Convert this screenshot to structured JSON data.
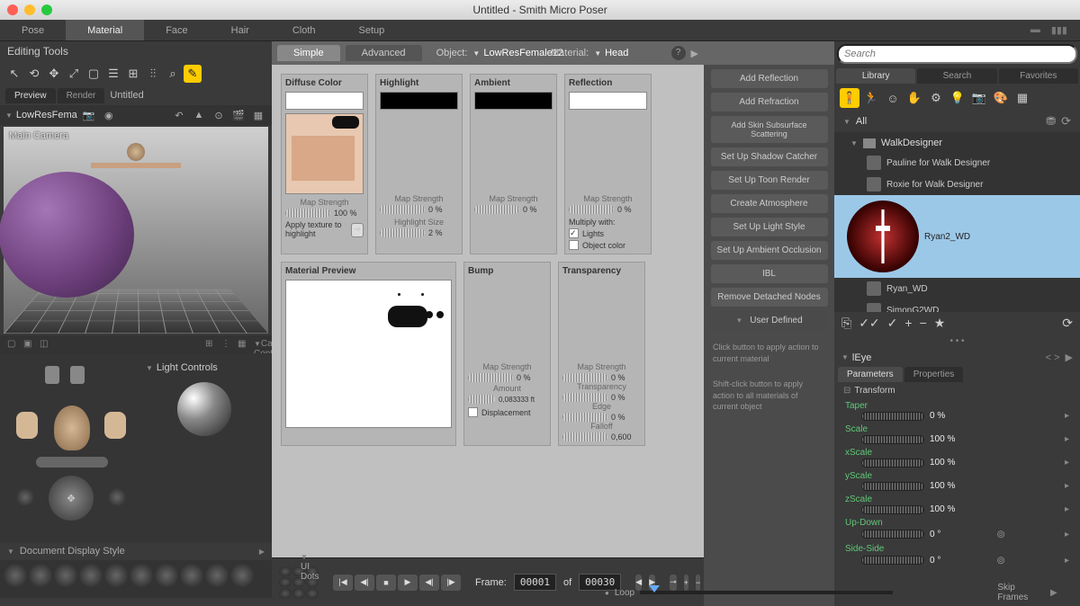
{
  "window": {
    "title": "Untitled - Smith Micro Poser"
  },
  "mainTabs": {
    "items": [
      "Pose",
      "Material",
      "Face",
      "Hair",
      "Cloth",
      "Setup"
    ],
    "active": "Material"
  },
  "leftPanel": {
    "editingTools": "Editing Tools",
    "previewTab": "Preview",
    "renderTab": "Render",
    "untitled": "Untitled",
    "figureDropdown": "LowResFema",
    "viewportLabel": "Main Camera",
    "cameraControls": "Camera Controls",
    "lightControls": "Light Controls",
    "displayStyle": "Document Display Style"
  },
  "center": {
    "simpleTab": "Simple",
    "advancedTab": "Advanced",
    "objectLabel": "Object:",
    "objectValue": "LowResFemale12",
    "materialLabel": "Material:",
    "materialValue": "Head",
    "diffuse": {
      "title": "Diffuse Color",
      "mapStrength": "Map Strength",
      "mapVal": "100 %",
      "apply": "Apply texture to highlight"
    },
    "highlight": {
      "title": "Highlight",
      "mapStrength": "Map Strength",
      "mapVal": "0 %",
      "sizeLabel": "Highlight Size",
      "sizeVal": "2 %"
    },
    "ambient": {
      "title": "Ambient",
      "mapStrength": "Map Strength",
      "mapVal": "0 %"
    },
    "reflection": {
      "title": "Reflection",
      "mapStrength": "Map Strength",
      "mapVal": "0 %",
      "multiply": "Multiply with:",
      "lights": "Lights",
      "objColor": "Object color"
    },
    "preview": {
      "title": "Material Preview"
    },
    "bump": {
      "title": "Bump",
      "mapStrength": "Map Strength",
      "mapVal": "0 %",
      "amountLabel": "Amount",
      "amountVal": "0,083333 ft",
      "dispLabel": "Displacement"
    },
    "transparency": {
      "title": "Transparency",
      "mapStrength": "Map Strength",
      "mapVal": "0 %",
      "transLabel": "Transparency",
      "transVal": "0 %",
      "edgeLabel": "Edge",
      "edgeVal": "0 %",
      "falloffLabel": "Falloff",
      "falloffVal": "0,600"
    }
  },
  "actions": {
    "buttons": [
      "Add Reflection",
      "Add Refraction",
      "Add Skin Subsurface Scattering",
      "Set Up Shadow Catcher",
      "Set Up Toon Render",
      "Create Atmosphere",
      "Set Up Light Style",
      "Set Up Ambient Occlusion",
      "IBL",
      "Remove Detached Nodes",
      "User Defined"
    ],
    "hint1": "Click button to apply action to current material",
    "hint2": "Shift-click button to apply action to all materials of current object"
  },
  "library": {
    "searchPlaceholder": "Search",
    "tabs": [
      "Library",
      "Search",
      "Favorites"
    ],
    "all": "All",
    "folder": "WalkDesigner",
    "items": [
      {
        "label": "Pauline for Walk Designer"
      },
      {
        "label": "Roxie for Walk Designer"
      },
      {
        "label": "Ryan2_WD",
        "selected": true
      },
      {
        "label": "Ryan_WD"
      },
      {
        "label": "SimonG2WD"
      }
    ]
  },
  "params": {
    "header": "lEye",
    "tabs": [
      "Parameters",
      "Properties"
    ],
    "group": "Transform",
    "rows": [
      {
        "name": "Taper",
        "val": "0 %"
      },
      {
        "name": "Scale",
        "val": "100 %"
      },
      {
        "name": "xScale",
        "val": "100 %"
      },
      {
        "name": "yScale",
        "val": "100 %"
      },
      {
        "name": "zScale",
        "val": "100 %"
      },
      {
        "name": "Up-Down",
        "val": "0 °",
        "key": true
      },
      {
        "name": "Side-Side",
        "val": "0 °",
        "key": true
      }
    ]
  },
  "timeline": {
    "uiDots": "UI Dots",
    "frameLabel": "Frame:",
    "frameCur": "00001",
    "of": "of",
    "frameEnd": "00030",
    "loop": "Loop",
    "skipFrames": "Skip Frames"
  }
}
